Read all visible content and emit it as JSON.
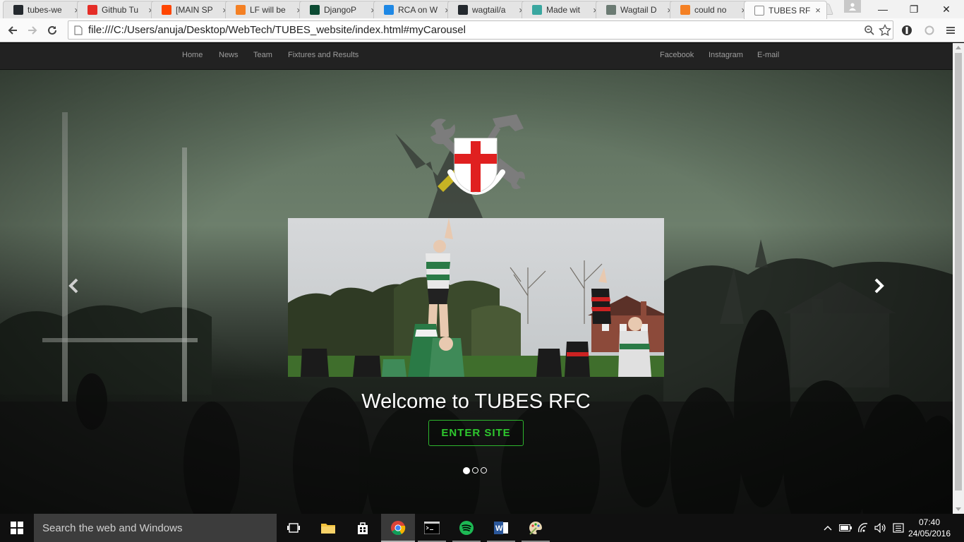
{
  "browser": {
    "tabs": [
      {
        "title": "tubes-we",
        "icon": "github-icon",
        "color": "#24292e"
      },
      {
        "title": "Github Tu",
        "icon": "youtube-icon",
        "color": "#e52d27"
      },
      {
        "title": "[MAIN SP",
        "icon": "reddit-icon",
        "color": "#ff4500"
      },
      {
        "title": "LF will be",
        "icon": "stackoverflow-icon",
        "color": "#f48024"
      },
      {
        "title": "DjangoP",
        "icon": "django-icon",
        "color": "#0c4b33"
      },
      {
        "title": "RCA on W",
        "icon": "pause-icon",
        "color": "#1e88e5"
      },
      {
        "title": "wagtail/a",
        "icon": "github-icon",
        "color": "#24292e"
      },
      {
        "title": "Made wit",
        "icon": "feather-icon",
        "color": "#3aa7a0"
      },
      {
        "title": "Wagtail D",
        "icon": "wagtail-icon",
        "color": "#6b7b73"
      },
      {
        "title": "could no",
        "icon": "stackoverflow-icon",
        "color": "#f48024"
      },
      {
        "title": "TUBES RF",
        "icon": "page-icon",
        "color": "#ffffff"
      }
    ],
    "tab_close": "×",
    "url": "file:///C:/Users/anuja/Desktop/WebTech/TUBES_website/index.html#myCarousel",
    "window_controls": {
      "minimize": "—",
      "maximize": "❐",
      "close": "✕"
    }
  },
  "site": {
    "nav_left": [
      "Home",
      "News",
      "Team",
      "Fixtures and Results"
    ],
    "nav_right": [
      "Facebook",
      "Instagram",
      "E-mail"
    ],
    "welcome_text": "Welcome to TUBES RFC",
    "enter_button": "ENTER SITE",
    "carousel": {
      "slide_count": 3,
      "active_slide": 1
    },
    "colors": {
      "nav_bg": "#222222",
      "nav_text": "#9d9d9d",
      "button_green": "#2ec82e",
      "crest_red": "#e02020"
    }
  },
  "taskbar": {
    "search_placeholder": "Search the web and Windows",
    "apps": [
      "task-view",
      "file-explorer",
      "store",
      "chrome",
      "command-prompt",
      "spotify",
      "word",
      "paint"
    ],
    "time": "07:40",
    "date": "24/05/2016"
  }
}
